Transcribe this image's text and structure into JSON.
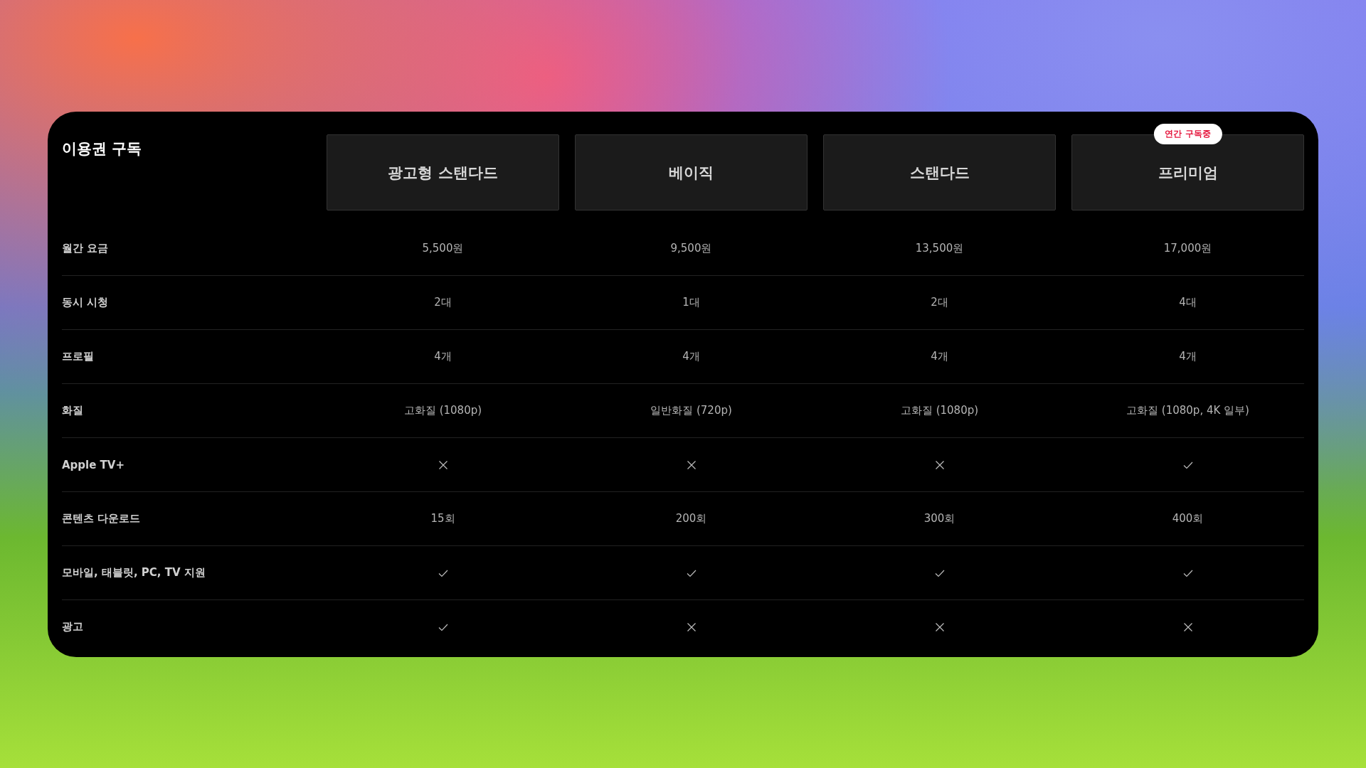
{
  "title": "이용권 구독",
  "plans": [
    {
      "name": "광고형 스탠다드"
    },
    {
      "name": "베이직"
    },
    {
      "name": "스탠다드"
    },
    {
      "name": "프리미엄",
      "badge": "연간 구독중"
    }
  ],
  "rows": [
    {
      "label": "월간 요금",
      "cells": [
        {
          "kind": "text",
          "text": "5,500원"
        },
        {
          "kind": "text",
          "text": "9,500원"
        },
        {
          "kind": "text",
          "text": "13,500원"
        },
        {
          "kind": "text",
          "text": "17,000원"
        }
      ]
    },
    {
      "label": "동시 시청",
      "cells": [
        {
          "kind": "text",
          "text": "2대"
        },
        {
          "kind": "text",
          "text": "1대"
        },
        {
          "kind": "text",
          "text": "2대"
        },
        {
          "kind": "text",
          "text": "4대"
        }
      ]
    },
    {
      "label": "프로필",
      "cells": [
        {
          "kind": "text",
          "text": "4개"
        },
        {
          "kind": "text",
          "text": "4개"
        },
        {
          "kind": "text",
          "text": "4개"
        },
        {
          "kind": "text",
          "text": "4개"
        }
      ]
    },
    {
      "label": "화질",
      "cells": [
        {
          "kind": "text",
          "text": "고화질 (1080p)"
        },
        {
          "kind": "text",
          "text": "일반화질 (720p)"
        },
        {
          "kind": "text",
          "text": "고화질 (1080p)"
        },
        {
          "kind": "text",
          "text": "고화질 (1080p, 4K 일부)"
        }
      ]
    },
    {
      "label": "Apple TV+",
      "cells": [
        {
          "kind": "mark",
          "included": false
        },
        {
          "kind": "mark",
          "included": false
        },
        {
          "kind": "mark",
          "included": false
        },
        {
          "kind": "mark",
          "included": true
        }
      ]
    },
    {
      "label": "콘텐츠 다운로드",
      "cells": [
        {
          "kind": "text",
          "text": "15회"
        },
        {
          "kind": "text",
          "text": "200회"
        },
        {
          "kind": "text",
          "text": "300회"
        },
        {
          "kind": "text",
          "text": "400회"
        }
      ]
    },
    {
      "label": "모바일, 태블릿, PC, TV 지원",
      "cells": [
        {
          "kind": "mark",
          "included": true
        },
        {
          "kind": "mark",
          "included": true
        },
        {
          "kind": "mark",
          "included": true
        },
        {
          "kind": "mark",
          "included": true
        }
      ]
    },
    {
      "label": "광고",
      "cells": [
        {
          "kind": "mark",
          "included": true
        },
        {
          "kind": "mark",
          "included": false
        },
        {
          "kind": "mark",
          "included": false
        },
        {
          "kind": "mark",
          "included": false
        }
      ]
    }
  ]
}
